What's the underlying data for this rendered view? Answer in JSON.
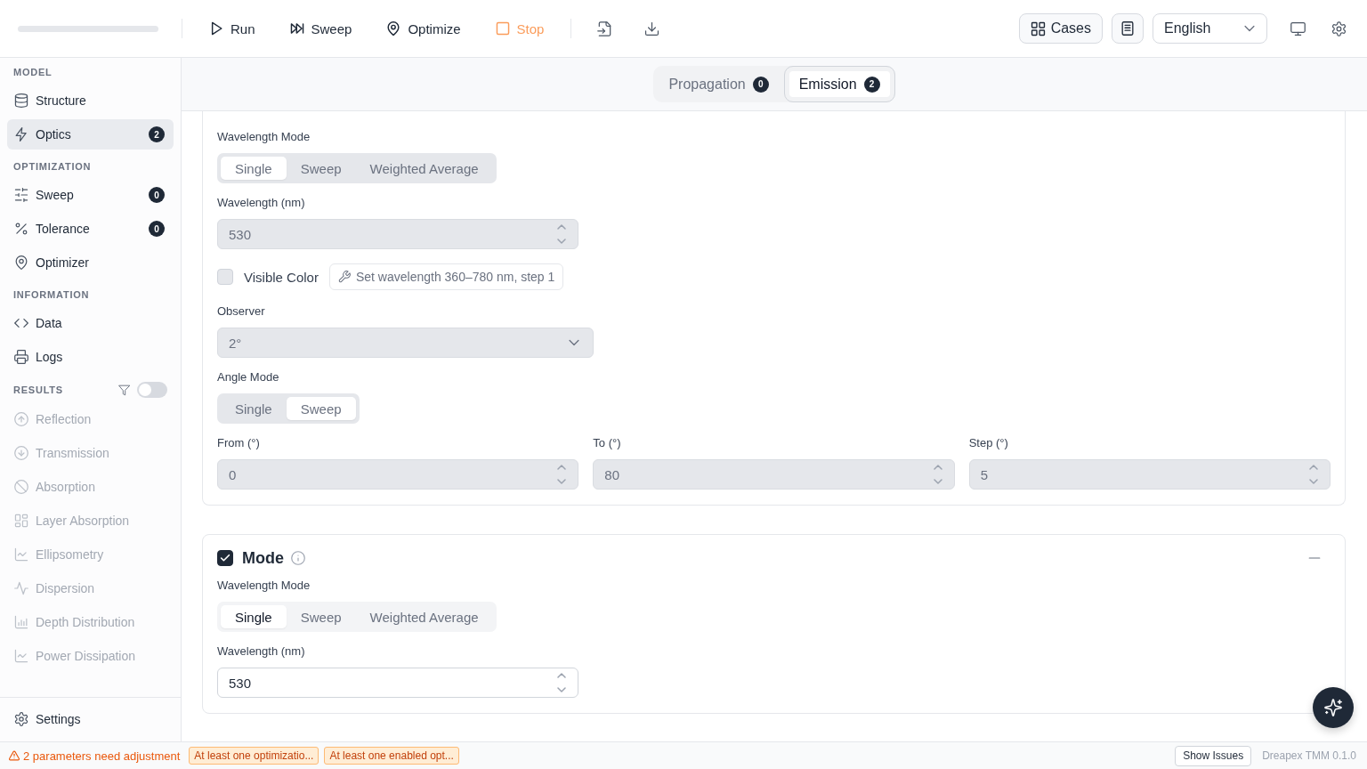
{
  "toolbar": {
    "actions": [
      {
        "kind": "run",
        "label": "Run",
        "disabled": false
      },
      {
        "kind": "sweep",
        "label": "Sweep",
        "disabled": false
      },
      {
        "kind": "optimize",
        "label": "Optimize",
        "disabled": false
      },
      {
        "kind": "stop",
        "label": "Stop",
        "disabled": true
      }
    ],
    "cases_button": "Cases",
    "language": "English"
  },
  "sidebar": {
    "sections": [
      {
        "heading": "MODEL",
        "items": [
          {
            "label": "Structure",
            "selected": false,
            "disabled": false
          },
          {
            "label": "Optics",
            "selected": true,
            "disabled": false,
            "badge": "2"
          }
        ]
      },
      {
        "heading": "OPTIMIZATION",
        "items": [
          {
            "label": "Sweep",
            "selected": false,
            "disabled": false,
            "badge": "0"
          },
          {
            "label": "Tolerance",
            "selected": false,
            "disabled": false,
            "badge": "0"
          },
          {
            "label": "Optimizer",
            "selected": false,
            "disabled": false
          }
        ]
      },
      {
        "heading": "INFORMATION",
        "items": [
          {
            "label": "Data",
            "selected": false,
            "disabled": false
          },
          {
            "label": "Logs",
            "selected": false,
            "disabled": false
          }
        ]
      },
      {
        "heading": "RESULTS",
        "filter_toggle": {
          "on": false
        },
        "items": [
          {
            "label": "Reflection",
            "selected": false,
            "disabled": true
          },
          {
            "label": "Transmission",
            "selected": false,
            "disabled": true
          },
          {
            "label": "Absorption",
            "selected": false,
            "disabled": true
          },
          {
            "label": "Layer Absorption",
            "selected": false,
            "disabled": true
          },
          {
            "label": "Ellipsometry",
            "selected": false,
            "disabled": true
          },
          {
            "label": "Dispersion",
            "selected": false,
            "disabled": true
          },
          {
            "label": "Depth Distribution",
            "selected": false,
            "disabled": true
          },
          {
            "label": "Power Dissipation",
            "selected": false,
            "disabled": true
          }
        ]
      }
    ],
    "footer_item": {
      "label": "Settings"
    }
  },
  "tabs": [
    {
      "label": "Propagation",
      "badge": "0",
      "selected": false
    },
    {
      "label": "Emission",
      "badge": "2",
      "selected": true
    }
  ],
  "sections": [
    {
      "enabled": false,
      "fields": [
        {
          "kind": "segmented",
          "label": "Wavelength Mode",
          "options": [
            {
              "label": "Single",
              "selected": true
            },
            {
              "label": "Sweep",
              "selected": false
            },
            {
              "label": "Weighted Average",
              "selected": false
            }
          ]
        },
        {
          "kind": "number",
          "label": "Wavelength (nm)",
          "value": "530"
        },
        {
          "kind": "checkbox",
          "label": "Visible Color",
          "checked": false,
          "hint": "Set wavelength 360–780 nm, step 1"
        },
        {
          "kind": "select",
          "label": "Observer",
          "value": "2°"
        },
        {
          "kind": "segmented",
          "label": "Angle Mode",
          "options": [
            {
              "label": "Single",
              "selected": false
            },
            {
              "label": "Sweep",
              "selected": true
            }
          ]
        },
        {
          "kind": "range",
          "inputs": [
            {
              "label": "From (°)",
              "value": "0"
            },
            {
              "label": "To (°)",
              "value": "80"
            },
            {
              "label": "Step (°)",
              "value": "5"
            }
          ]
        }
      ]
    },
    {
      "title": "Mode",
      "enabled": true,
      "fields": [
        {
          "kind": "segmented",
          "label": "Wavelength Mode",
          "options": [
            {
              "label": "Single",
              "selected": true
            },
            {
              "label": "Sweep",
              "selected": false
            },
            {
              "label": "Weighted Average",
              "selected": false
            }
          ]
        },
        {
          "kind": "number",
          "label": "Wavelength (nm)",
          "value": "530"
        }
      ]
    }
  ],
  "status_bar": {
    "warning": "2 parameters need adjustment",
    "tags": [
      "At least one optimizatio...",
      "At least one enabled opt..."
    ],
    "show_issues": "Show Issues",
    "version": "Dreapex TMM 0.1.0"
  }
}
